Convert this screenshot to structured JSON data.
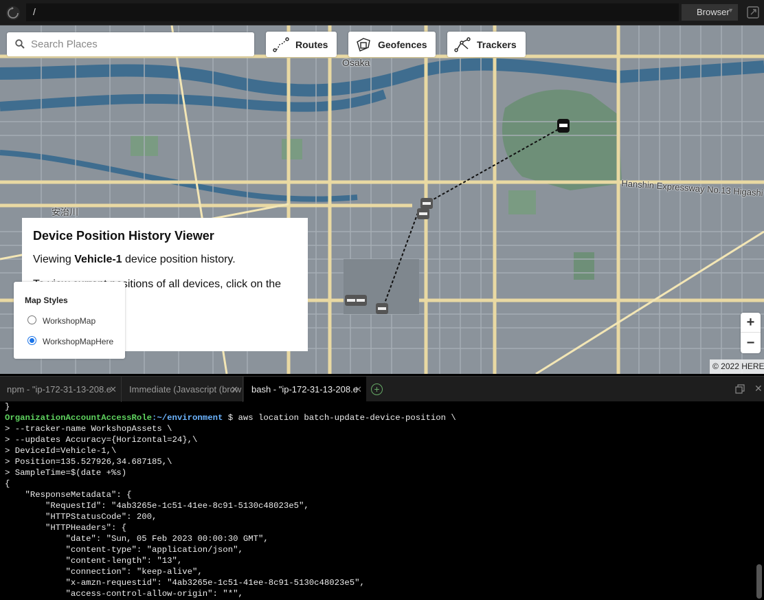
{
  "address_bar": {
    "url": "/",
    "browser_label": "Browser"
  },
  "map": {
    "search": {
      "placeholder": "Search Places"
    },
    "buttons": {
      "routes": "Routes",
      "geofences": "Geofences",
      "trackers": "Trackers"
    },
    "labels": {
      "osaka": "Osaka",
      "river": "安治川",
      "expressway": "Hanshin Expressway No.13 Higashi"
    },
    "history_panel": {
      "title": "Device Position History Viewer",
      "viewing_prefix": "Viewing ",
      "device": "Vehicle-1",
      "viewing_suffix": " device position history.",
      "hint": "To view current positions of all devices, click on the"
    },
    "map_styles": {
      "title": "Map Styles",
      "options": [
        "WorkshopMap",
        "WorkshopMapHere"
      ],
      "selected": "WorkshopMapHere"
    },
    "zoom": {
      "in": "+",
      "out": "−"
    },
    "attribution": "© 2022 HERE"
  },
  "terminal_tabs": [
    {
      "label": "npm - \"ip-172-31-13-208.e",
      "active": false
    },
    {
      "label": "Immediate (Javascript (brow",
      "active": false
    },
    {
      "label": "bash - \"ip-172-31-13-208.e",
      "active": true
    }
  ],
  "terminal": {
    "prompt_user": "OrganizationAccountAccessRole",
    "prompt_path": ":~/environment",
    "prompt_sign": " $ ",
    "command": "aws location batch-update-device-position \\",
    "lines_before": "}",
    "continuation_lines": [
      "> --tracker-name WorkshopAssets \\",
      "> --updates Accuracy={Horizontal=24},\\",
      "> DeviceId=Vehicle-1,\\",
      "> Position=135.527926,34.687185,\\",
      "> SampleTime=$(date +%s)"
    ],
    "output_lines": [
      "{",
      "    \"ResponseMetadata\": {",
      "        \"RequestId\": \"4ab3265e-1c51-41ee-8c91-5130c48023e5\",",
      "        \"HTTPStatusCode\": 200,",
      "        \"HTTPHeaders\": {",
      "            \"date\": \"Sun, 05 Feb 2023 00:00:30 GMT\",",
      "            \"content-type\": \"application/json\",",
      "            \"content-length\": \"13\",",
      "            \"connection\": \"keep-alive\",",
      "            \"x-amzn-requestid\": \"4ab3265e-1c51-41ee-8c91-5130c48023e5\",",
      "            \"access-control-allow-origin\": \"*\","
    ]
  }
}
